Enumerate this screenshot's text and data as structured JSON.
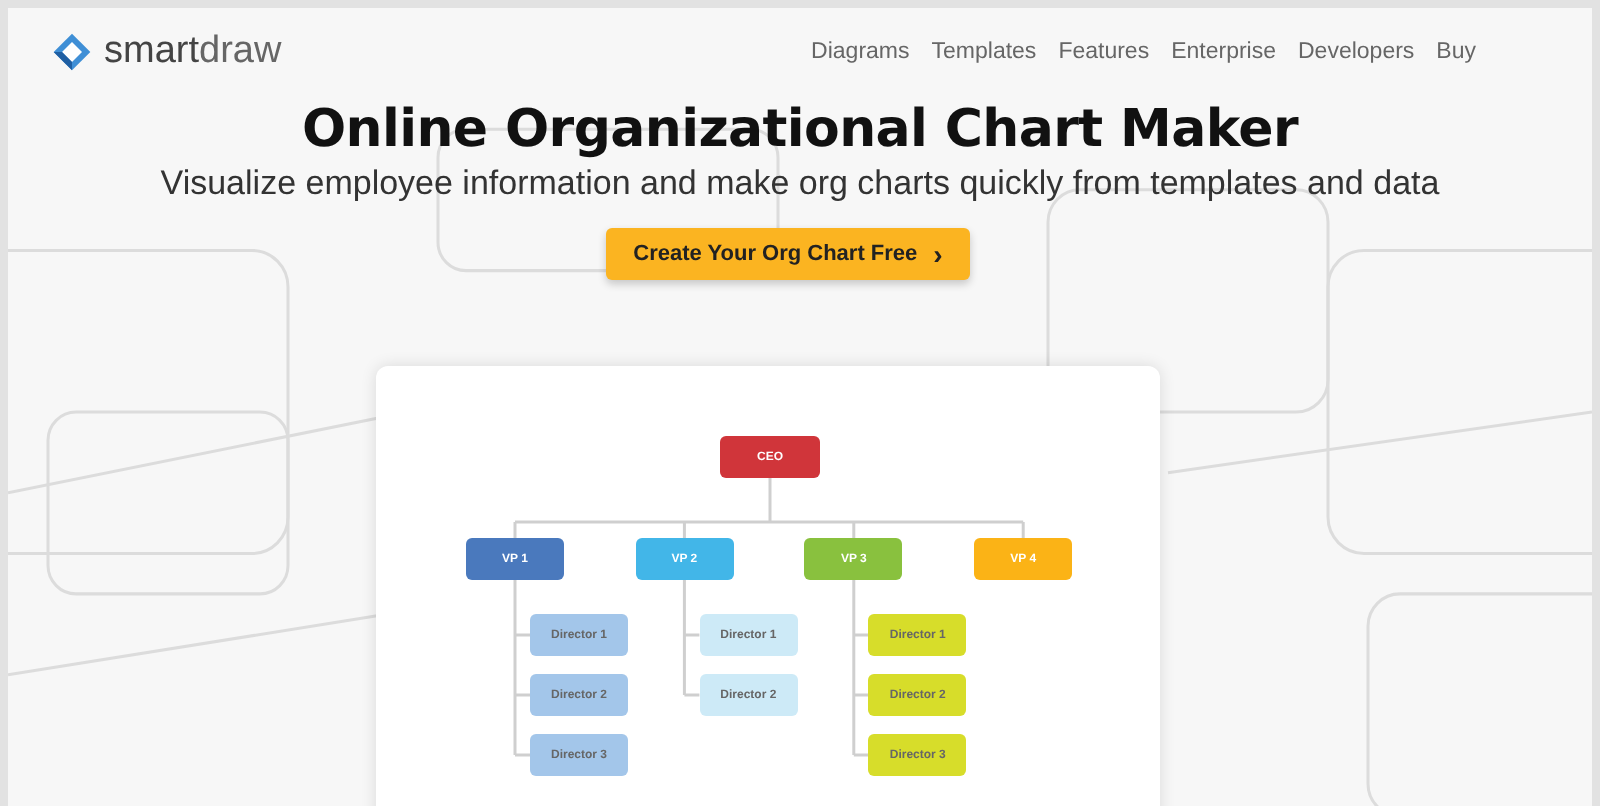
{
  "brand": {
    "name_part_1": "smart",
    "name_part_2": "draw"
  },
  "nav": [
    "Diagrams",
    "Templates",
    "Features",
    "Enterprise",
    "Developers",
    "Buy"
  ],
  "headline": "Online Organizational Chart Maker",
  "subtitle": "Visualize employee information and make org charts quickly from templates and data",
  "cta": {
    "label": "Create Your Org Chart Free",
    "arrow": "›"
  },
  "org_chart": {
    "root": {
      "label": "CEO",
      "color": "#d0353a"
    },
    "vps": [
      {
        "label": "VP 1",
        "color": "#4a79bd",
        "directors": [
          {
            "label": "Director 1",
            "color": "#a3c6ea"
          },
          {
            "label": "Director 2",
            "color": "#a3c6ea"
          },
          {
            "label": "Director 3",
            "color": "#a3c6ea"
          }
        ]
      },
      {
        "label": "VP 2",
        "color": "#42b6e8",
        "directors": [
          {
            "label": "Director 1",
            "color": "#cdeaf7"
          },
          {
            "label": "Director 2",
            "color": "#cdeaf7"
          }
        ]
      },
      {
        "label": "VP 3",
        "color": "#89c13e",
        "directors": [
          {
            "label": "Director 1",
            "color": "#d7dd2a"
          },
          {
            "label": "Director 2",
            "color": "#d7dd2a"
          },
          {
            "label": "Director 3",
            "color": "#d7dd2a"
          }
        ]
      },
      {
        "label": "VP 4",
        "color": "#fbb316"
      }
    ]
  }
}
